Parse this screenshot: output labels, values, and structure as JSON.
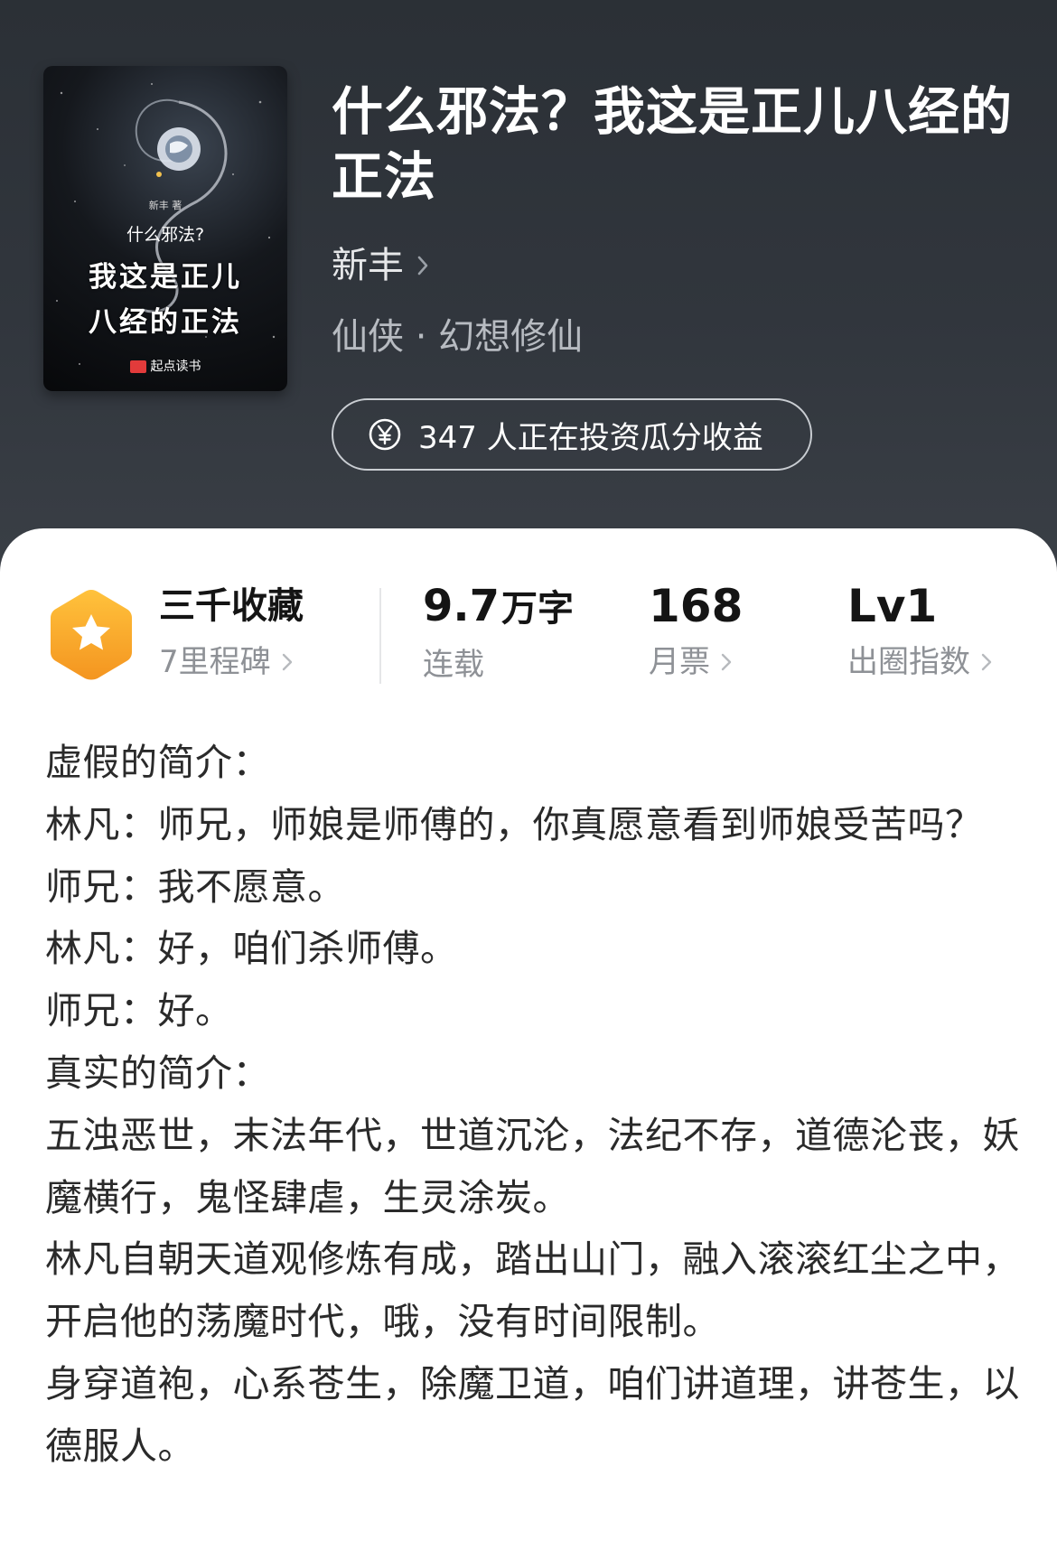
{
  "header": {
    "cover": {
      "author": "新丰 著",
      "subtitle": "什么邪法?",
      "title_line1": "我这是正儿",
      "title_line2": "八经的正法",
      "brand": "起点读书"
    },
    "title": "什么邪法？我这是正儿八经的正法",
    "author": "新丰",
    "genre": "仙侠 · 幻想修仙",
    "invest_text": "347 人正在投资瓜分收益"
  },
  "stats": {
    "collect": {
      "main": "三千收藏",
      "sub": "7里程碑"
    },
    "words": {
      "number": "9.7",
      "unit": "万字",
      "sub": "连载"
    },
    "monthly": {
      "main": "168",
      "sub": "月票"
    },
    "level": {
      "main": "Lv1",
      "sub": "出圈指数"
    }
  },
  "description": [
    "虚假的简介：",
    "林凡：师兄，师娘是师傅的，你真愿意看到师娘受苦吗？",
    "师兄：我不愿意。",
    "林凡：好，咱们杀师傅。",
    "师兄：好。",
    "真实的简介：",
    "五浊恶世，末法年代，世道沉沦，法纪不存，道德沦丧，妖魔横行，鬼怪肆虐，生灵涂炭。",
    "林凡自朝天道观修炼有成，踏出山门，融入滚滚红尘之中，开启他的荡魔时代，哦，没有时间限制。",
    "身穿道袍，心系苍生，除魔卫道，咱们讲道理，讲苍生，以德服人。"
  ],
  "colors": {
    "header_bg": "#2f343a",
    "badge_orange": "#f6a02b",
    "text_dark": "#141414",
    "text_muted": "#8e9196"
  },
  "icons": [
    "chevron-right-icon",
    "yen-coin-icon",
    "star-badge-icon",
    "dragon-cover-art"
  ]
}
